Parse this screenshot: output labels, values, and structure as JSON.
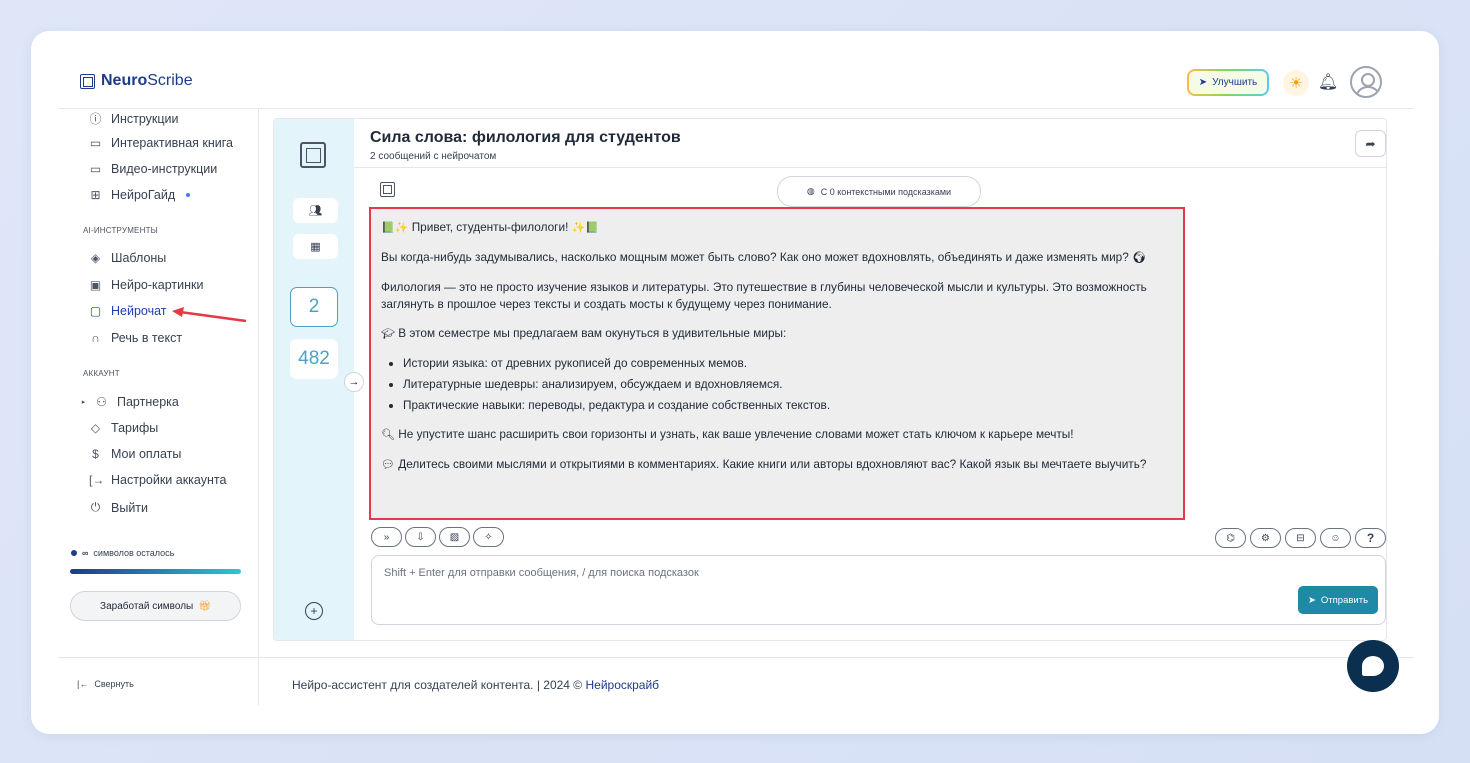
{
  "header": {
    "logo_bold": "Neuro",
    "logo_light": "Scribe",
    "upgrade_label": "Улучшить"
  },
  "sidebar": {
    "items_top": [
      {
        "label": "Инструкции",
        "icon": "help-circle-icon"
      },
      {
        "label": "Интерактивная книга",
        "icon": "book-icon"
      },
      {
        "label": "Видео-инструкции",
        "icon": "video-icon"
      },
      {
        "label": "НейроГайд",
        "icon": "guide-icon"
      }
    ],
    "section_ai": "AI-ИНСТРУМЕНТЫ",
    "items_ai": [
      {
        "label": "Шаблоны",
        "icon": "layers-icon"
      },
      {
        "label": "Нейро-картинки",
        "icon": "image-icon"
      },
      {
        "label": "Нейрочат",
        "icon": "chat-icon"
      },
      {
        "label": "Речь в текст",
        "icon": "headphones-icon"
      }
    ],
    "section_account": "АККАУНТ",
    "items_account": [
      {
        "label": "Партнерка",
        "icon": "users-icon"
      },
      {
        "label": "Тарифы",
        "icon": "tag-icon"
      },
      {
        "label": "Мои оплаты",
        "icon": "dollar-icon"
      },
      {
        "label": "Настройки аккаунта",
        "icon": "login-icon"
      },
      {
        "label": "Выйти",
        "icon": "power-icon"
      }
    ],
    "symbols_value": "∞",
    "symbols_label": "символов осталось",
    "symbols_fill_fraction": 1.0,
    "earn_label": "Заработай символы",
    "collapse_label": "Свернуть"
  },
  "chat": {
    "title": "Сила слова: филология для студентов",
    "subtitle": "2 сообщений с нейрочатом",
    "hints_label": "С 0 контекстными подсказками",
    "counter_1": "2",
    "counter_2": "482",
    "message": {
      "greeting": "Привет, студенты-филологи!",
      "p1": "Вы когда-нибудь задумывались, насколько мощным может быть слово? Как оно может вдохновлять, объединять и даже изменять мир?",
      "p2": "Филология — это не просто изучение языков и литературы. Это путешествие в глубины человеческой мысли и культуры. Это возможность заглянуть в прошлое через тексты и создать мосты к будущему через понимание.",
      "p3": "В этом семестре мы предлагаем вам окунуться в удивительные миры:",
      "bullets": [
        "Истории языка: от древних рукописей до современных мемов.",
        "Литературные шедевры: анализируем, обсуждаем и вдохновляемся.",
        "Практические навыки: переводы, редактура и создание собственных текстов."
      ],
      "p4": "Не упустите шанс расширить свои горизонты и узнать, как ваше увлечение словами может стать ключом к карьере мечты!",
      "p5": "Делитесь своими мыслями и открытиями в комментариях. Какие книги или авторы вдохновляют вас? Какой язык вы мечтаете выучить?"
    },
    "input_placeholder": "Shift + Enter для отправки сообщения, / для поиска подсказок",
    "send_label": "Отправить"
  },
  "footer": {
    "text": "Нейро-ассистент для создателей контента.  | 2024 ©",
    "link": "Нейроскрайб"
  },
  "colors": {
    "brand": "#1e3a8a",
    "accent": "#1f8aa6",
    "highlight": "#e53945"
  }
}
